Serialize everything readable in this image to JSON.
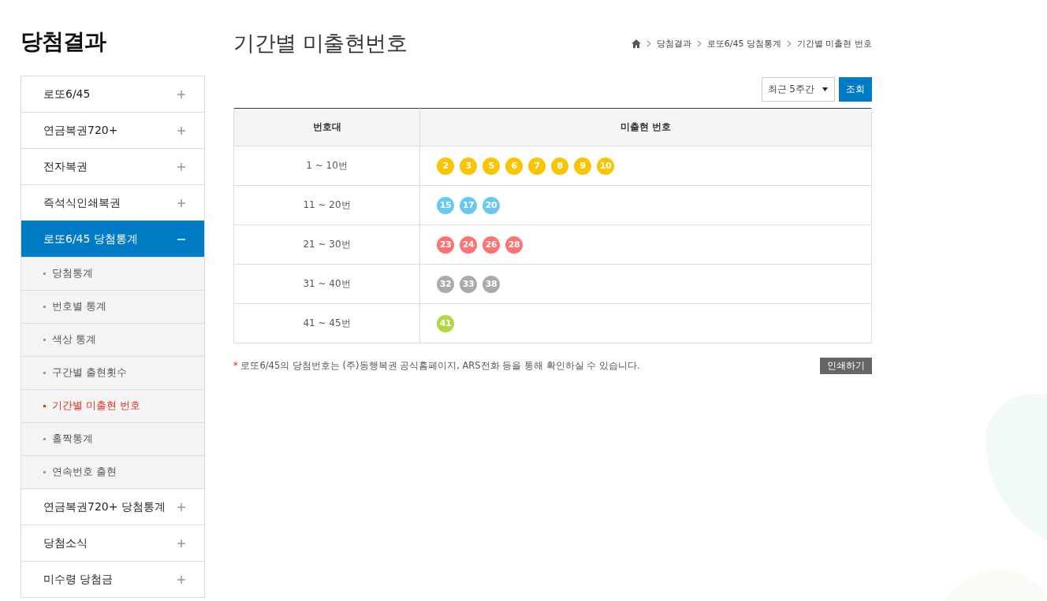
{
  "sidebar": {
    "title": "당첨결과",
    "items": [
      {
        "label": "로또6/45",
        "expanded": false
      },
      {
        "label": "연금복권720+",
        "expanded": false
      },
      {
        "label": "전자복권",
        "expanded": false
      },
      {
        "label": "즉석식인쇄복권",
        "expanded": false
      },
      {
        "label": "로또6/45 당첨통계",
        "expanded": true,
        "children": [
          {
            "label": "당첨통계",
            "selected": false
          },
          {
            "label": "번호별 통계",
            "selected": false
          },
          {
            "label": "색상 통계",
            "selected": false
          },
          {
            "label": "구간별 출현횟수",
            "selected": false
          },
          {
            "label": "기간별 미출현 번호",
            "selected": true
          },
          {
            "label": "홀짝통계",
            "selected": false
          },
          {
            "label": "연속번호 출현",
            "selected": false
          }
        ]
      },
      {
        "label": "연금복권720+ 당첨통계",
        "expanded": false
      },
      {
        "label": "당첨소식",
        "expanded": false
      },
      {
        "label": "미수령 당첨금",
        "expanded": false
      }
    ]
  },
  "page_title": "기간별 미출현번호",
  "breadcrumb": [
    "당첨결과",
    "로또6/45 당첨통계",
    "기간별 미출현 번호"
  ],
  "period_select": {
    "value": "최근 5주간"
  },
  "search_button": "조회",
  "table": {
    "columns": [
      "번호대",
      "미출현 번호"
    ],
    "rows": [
      {
        "range": "1 ~ 10번",
        "color": "#fbc400",
        "numbers": [
          "2",
          "3",
          "5",
          "6",
          "7",
          "8",
          "9",
          "10"
        ]
      },
      {
        "range": "11 ~ 20번",
        "color": "#69c8f2",
        "numbers": [
          "15",
          "17",
          "20"
        ]
      },
      {
        "range": "21 ~ 30번",
        "color": "#ff7272",
        "numbers": [
          "23",
          "24",
          "26",
          "28"
        ]
      },
      {
        "range": "31 ~ 40번",
        "color": "#aaaaaa",
        "numbers": [
          "32",
          "33",
          "38"
        ]
      },
      {
        "range": "41 ~ 45번",
        "color": "#b0d840",
        "numbers": [
          "41"
        ]
      }
    ]
  },
  "note": {
    "mark": "*",
    "text": "로또6/45의 당첨번호는 (주)동행복권 공식홈페이지, ARS전화 등을 통해 확인하실 수 있습니다."
  },
  "print_button": "인쇄하기"
}
